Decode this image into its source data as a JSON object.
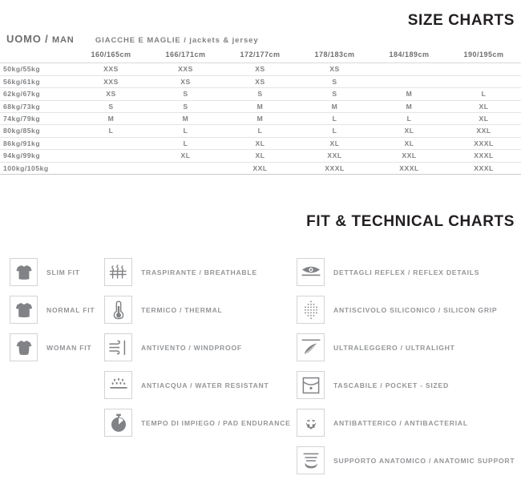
{
  "titles": {
    "size_charts": "SIZE CHARTS",
    "fit_charts": "FIT & TECHNICAL CHARTS"
  },
  "size_chart": {
    "category_it": "UOMO",
    "category_sep": "/",
    "category_en": "MAN",
    "subcategory": "GIACCHE E MAGLIE / jackets & jersey",
    "corner_header": "",
    "columns": [
      "160/165cm",
      "166/171cm",
      "172/177cm",
      "178/183cm",
      "184/189cm",
      "190/195cm"
    ],
    "rows": [
      {
        "weight": "50kg/55kg",
        "sizes": [
          "XXS",
          "XXS",
          "XS",
          "XS",
          "",
          ""
        ]
      },
      {
        "weight": "56kg/61kg",
        "sizes": [
          "XXS",
          "XS",
          "XS",
          "S",
          "",
          ""
        ]
      },
      {
        "weight": "62kg/67kg",
        "sizes": [
          "XS",
          "S",
          "S",
          "S",
          "M",
          "L"
        ]
      },
      {
        "weight": "68kg/73kg",
        "sizes": [
          "S",
          "S",
          "M",
          "M",
          "M",
          "XL"
        ]
      },
      {
        "weight": "74kg/79kg",
        "sizes": [
          "M",
          "M",
          "M",
          "L",
          "L",
          "XL"
        ]
      },
      {
        "weight": "80kg/85kg",
        "sizes": [
          "L",
          "L",
          "L",
          "L",
          "XL",
          "XXL"
        ]
      },
      {
        "weight": "86kg/91kg",
        "sizes": [
          "",
          "L",
          "XL",
          "XL",
          "XL",
          "XXXL"
        ]
      },
      {
        "weight": "94kg/99kg",
        "sizes": [
          "",
          "XL",
          "XL",
          "XXL",
          "XXL",
          "XXXL"
        ]
      },
      {
        "weight": "100kg/105kg",
        "sizes": [
          "",
          "",
          "XXL",
          "XXXL",
          "XXXL",
          "XXXL"
        ]
      }
    ]
  },
  "fit_column": [
    {
      "icon": "tshirt-slim-icon",
      "label": "SLIM FIT"
    },
    {
      "icon": "tshirt-normal-icon",
      "label": "NORMAL FIT"
    },
    {
      "icon": "tshirt-woman-icon",
      "label": "WOMAN FIT"
    }
  ],
  "tech_column_left": [
    {
      "icon": "breathable-icon",
      "label": "TRASPIRANTE / BREATHABLE"
    },
    {
      "icon": "thermometer-icon",
      "label": "TERMICO / THERMAL"
    },
    {
      "icon": "windproof-icon",
      "label": "ANTIVENTO / WINDPROOF"
    },
    {
      "icon": "water-resistant-icon",
      "label": "ANTIACQUA / WATER RESISTANT"
    },
    {
      "icon": "stopwatch-icon",
      "label": "TEMPO DI IMPIEGO / PAD ENDURANCE"
    }
  ],
  "tech_column_right": [
    {
      "icon": "reflex-eye-icon",
      "label": "DETTAGLI REFLEX / REFLEX DETAILS"
    },
    {
      "icon": "silicon-grip-icon",
      "label": "ANTISCIVOLO SILICONICO / SILICON GRIP"
    },
    {
      "icon": "feather-icon",
      "label": "ULTRALEGGERO / ULTRALIGHT"
    },
    {
      "icon": "pocket-icon",
      "label": "TASCABILE / POCKET - SIZED"
    },
    {
      "icon": "antibacterial-icon",
      "label": "ANTIBATTERICO / ANTIBACTERIAL"
    },
    {
      "icon": "anatomic-support-icon",
      "label": "SUPPORTO ANATOMICO / ANATOMIC SUPPORT"
    }
  ],
  "colors": {
    "title": "#231f20",
    "table_text": "#808285",
    "icon_gray": "#808285",
    "box_border": "#d2d3d4",
    "rule": "#e3e4e5"
  }
}
